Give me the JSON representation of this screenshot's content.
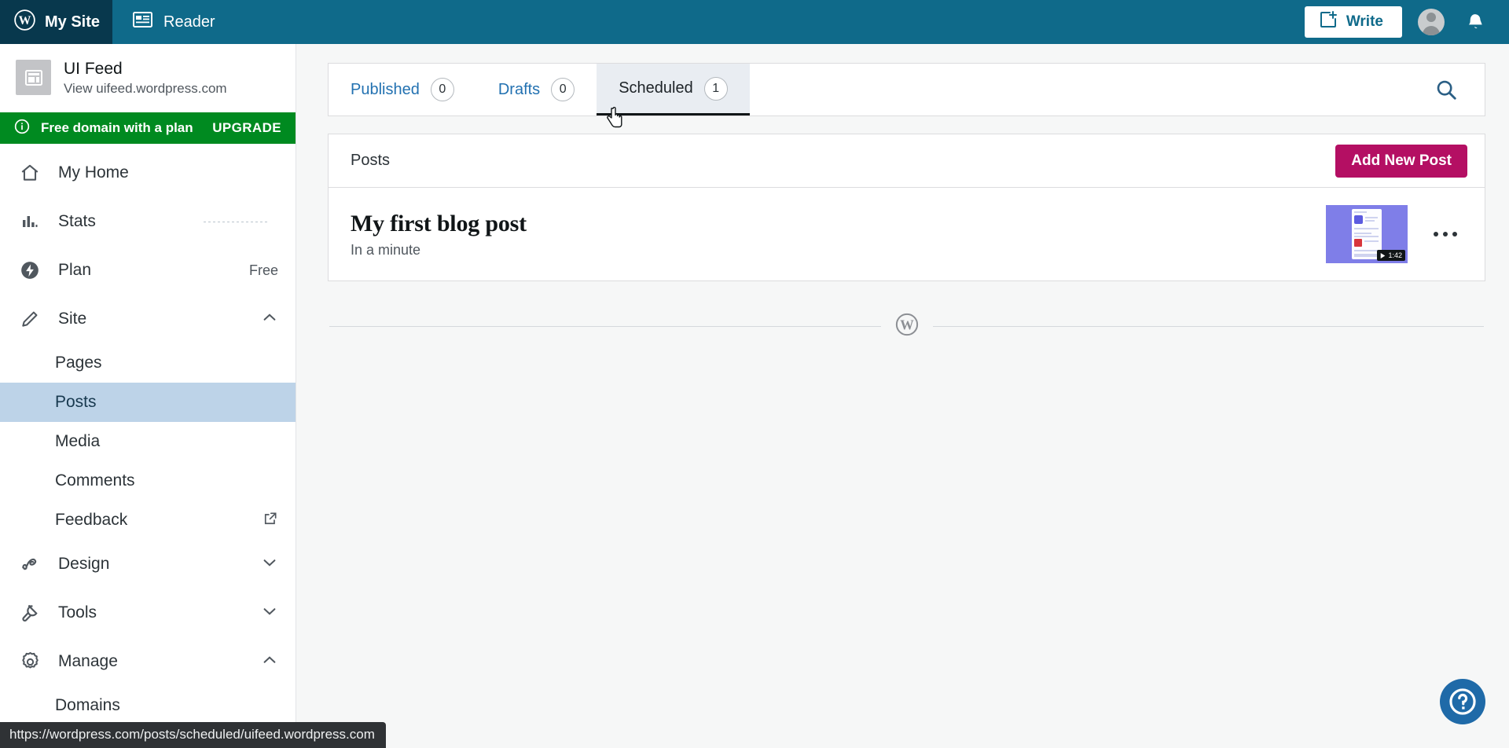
{
  "masthead": {
    "my_site_label": "My Site",
    "reader_label": "Reader",
    "write_label": "Write",
    "wordpress_icon": "wordpress-logo-icon",
    "reader_icon": "reader-icon",
    "write_icon": "write-plus-icon",
    "avatar_icon": "user-avatar-icon",
    "bell_icon": "notifications-bell-icon",
    "bg_color": "#0f6a8a",
    "my_site_bg_color": "#08384d"
  },
  "sidebar": {
    "site": {
      "name": "UI Feed",
      "url": "View uifeed.wordpress.com",
      "thumb_icon": "site-placeholder-icon"
    },
    "upsell": {
      "text": "Free domain with a plan",
      "cta": "UPGRADE",
      "icon": "info-circle-icon",
      "bg_color": "#008a20"
    },
    "items": [
      {
        "label": "My Home",
        "icon": "home-icon",
        "right": "",
        "level": "top"
      },
      {
        "label": "Stats",
        "icon": "stats-bars-icon",
        "right": "",
        "level": "top"
      },
      {
        "label": "Plan",
        "icon": "plan-bolt-icon",
        "right": "Free",
        "level": "top"
      },
      {
        "label": "Site",
        "icon": "pencil-icon",
        "right": "chevron-up-icon",
        "level": "top"
      },
      {
        "label": "Pages",
        "icon": "",
        "right": "",
        "level": "sub"
      },
      {
        "label": "Posts",
        "icon": "",
        "right": "",
        "level": "sub"
      },
      {
        "label": "Media",
        "icon": "",
        "right": "",
        "level": "sub"
      },
      {
        "label": "Comments",
        "icon": "",
        "right": "",
        "level": "sub"
      },
      {
        "label": "Feedback",
        "icon": "",
        "right": "external-link-icon",
        "level": "sub"
      },
      {
        "label": "Design",
        "icon": "design-brush-icon",
        "right": "chevron-down-icon",
        "level": "top"
      },
      {
        "label": "Tools",
        "icon": "tools-wrench-icon",
        "right": "chevron-down-icon",
        "level": "top"
      },
      {
        "label": "Manage",
        "icon": "gear-icon",
        "right": "chevron-up-icon",
        "level": "top"
      },
      {
        "label": "Domains",
        "icon": "",
        "right": "",
        "level": "sub"
      }
    ],
    "active_item": "Posts",
    "active_bg_color": "#bdd3e8"
  },
  "tabs": {
    "items": [
      {
        "label": "Published",
        "count": "0",
        "active": false
      },
      {
        "label": "Drafts",
        "count": "0",
        "active": false
      },
      {
        "label": "Scheduled",
        "count": "1",
        "active": true
      }
    ],
    "search_icon": "search-icon"
  },
  "list": {
    "title": "Posts",
    "add_button_label": "Add New Post",
    "add_button_color": "#b40f63",
    "posts": [
      {
        "title": "My first blog post",
        "date": "In a minute",
        "thumb_duration": "1:42",
        "thumb_color": "#7f7ee8",
        "menu_icon": "ellipsis-menu-icon"
      }
    ]
  },
  "footer": {
    "divider_icon": "wordpress-logo-icon"
  },
  "overlays": {
    "status_url": "https://wordpress.com/posts/scheduled/uifeed.wordpress.com",
    "help_icon": "help-question-icon",
    "help_color": "#1f6aa8",
    "cursor_icon": "pointer-hand-cursor"
  }
}
